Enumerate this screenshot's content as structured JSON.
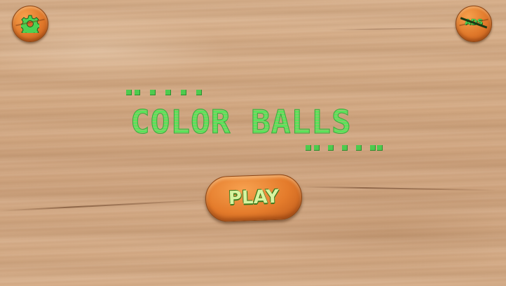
{
  "game": {
    "title": "COLOR BALLS",
    "play_label": "PLAY",
    "ads_label": "ADS"
  },
  "icons": {
    "settings": "gear-icon",
    "ads": "no-ads-icon"
  },
  "colors": {
    "title_green": "#5ce35b",
    "button_orange": "#e47b2b",
    "wood_background": "#d3a983"
  }
}
